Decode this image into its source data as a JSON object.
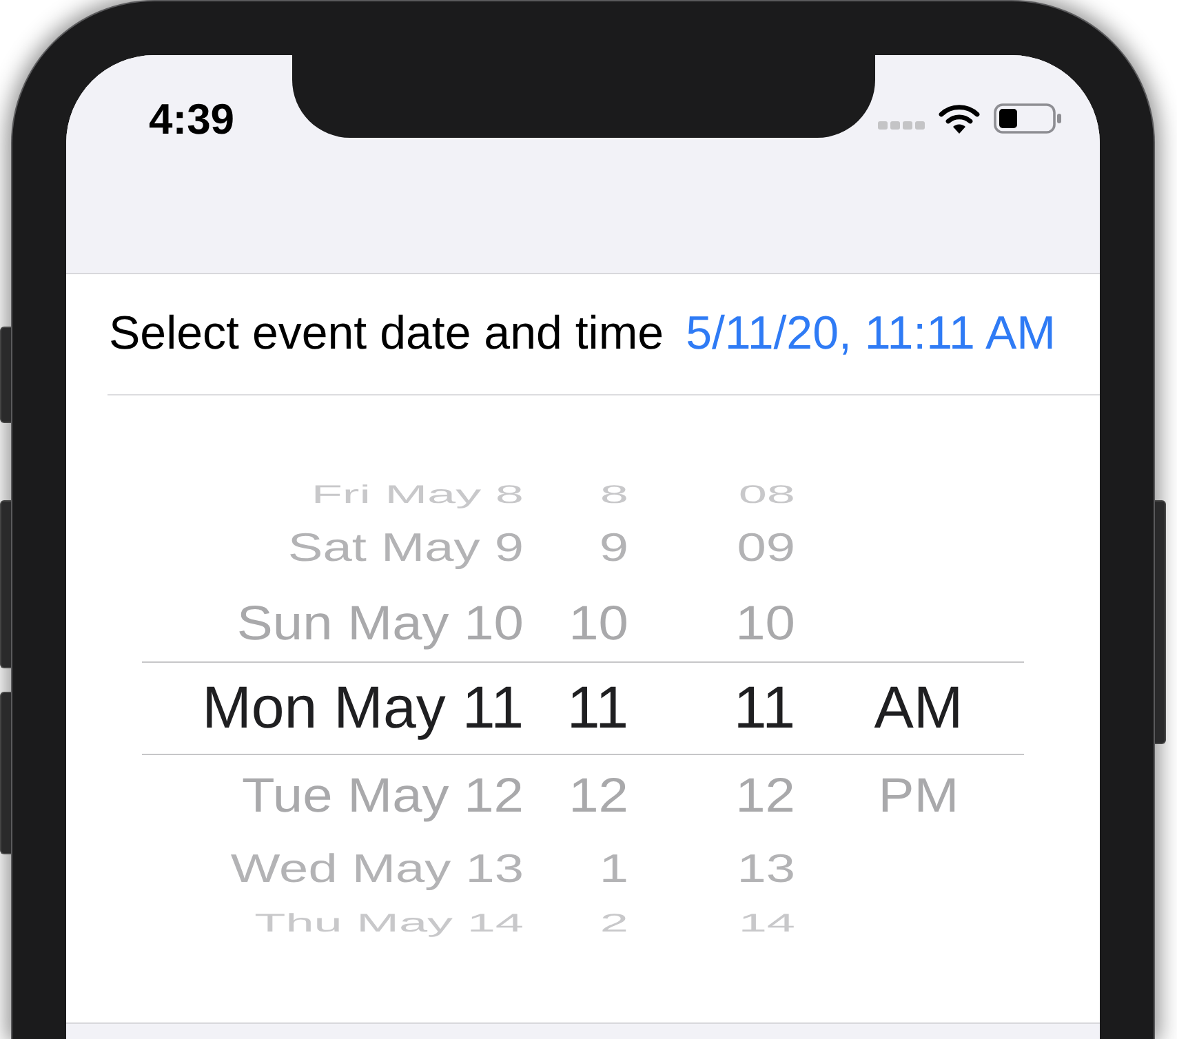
{
  "status_bar": {
    "time": "4:39"
  },
  "form_row": {
    "label": "Select event date and time",
    "value": "5/11/20, 11:11 AM"
  },
  "date_picker": {
    "columns": [
      {
        "kind": "date",
        "items": [
          {
            "text": "Fri May 8",
            "selected": false
          },
          {
            "text": "Sat May 9",
            "selected": false
          },
          {
            "text": "Sun May 10",
            "selected": false
          },
          {
            "text": "Mon May 11",
            "selected": true
          },
          {
            "text": "Tue May 12",
            "selected": false
          },
          {
            "text": "Wed May 13",
            "selected": false
          },
          {
            "text": "Thu May 14",
            "selected": false
          }
        ]
      },
      {
        "kind": "hour",
        "items": [
          {
            "text": "8",
            "selected": false
          },
          {
            "text": "9",
            "selected": false
          },
          {
            "text": "10",
            "selected": false
          },
          {
            "text": "11",
            "selected": true
          },
          {
            "text": "12",
            "selected": false
          },
          {
            "text": "1",
            "selected": false
          },
          {
            "text": "2",
            "selected": false
          }
        ]
      },
      {
        "kind": "minute",
        "items": [
          {
            "text": "08",
            "selected": false
          },
          {
            "text": "09",
            "selected": false
          },
          {
            "text": "10",
            "selected": false
          },
          {
            "text": "11",
            "selected": true
          },
          {
            "text": "12",
            "selected": false
          },
          {
            "text": "13",
            "selected": false
          },
          {
            "text": "14",
            "selected": false
          }
        ]
      },
      {
        "kind": "period",
        "items": [
          {
            "text": "AM",
            "selected": true
          },
          {
            "text": "PM",
            "selected": false
          }
        ]
      }
    ]
  }
}
